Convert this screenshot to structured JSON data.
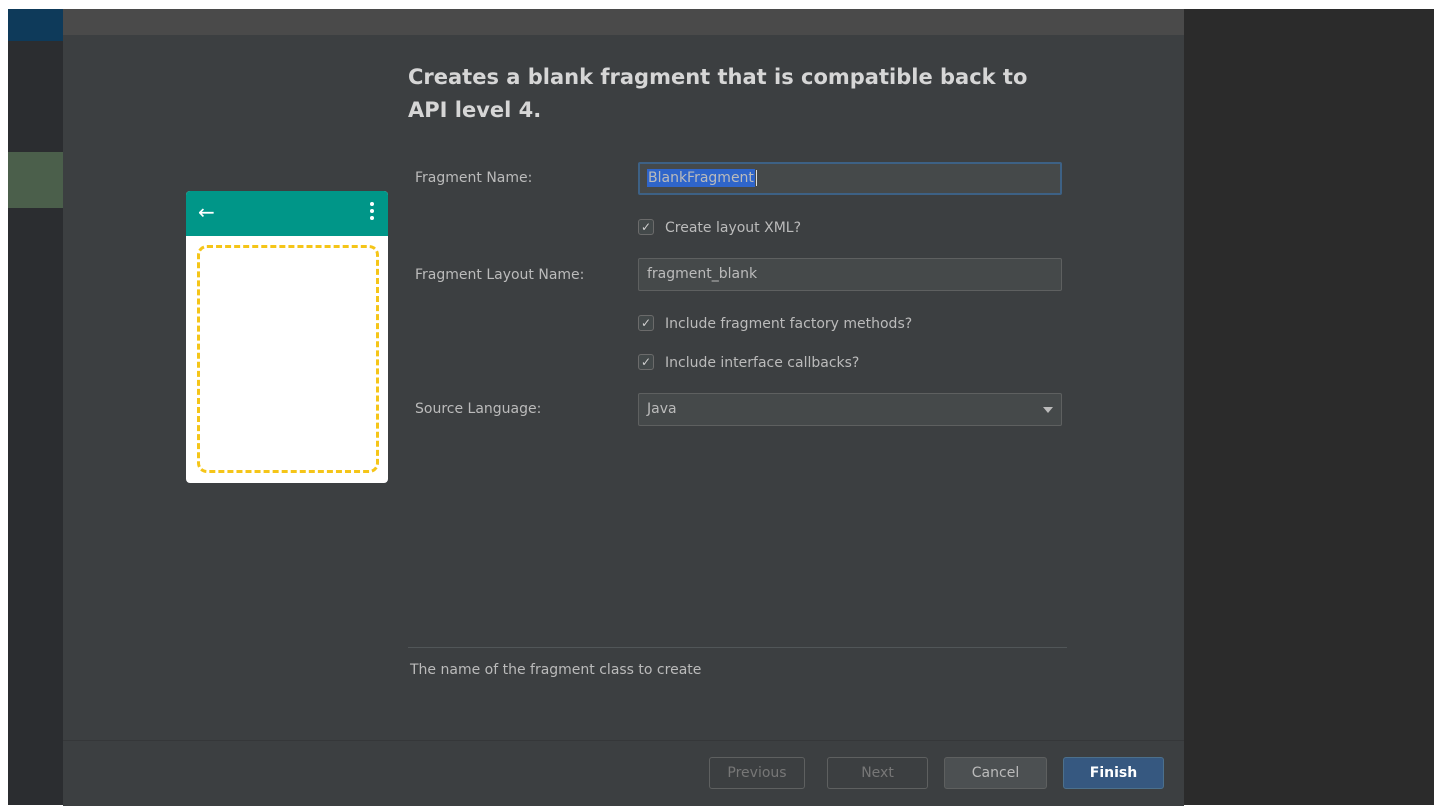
{
  "dialog": {
    "title": "Creates a blank fragment that is compatible back to API level 4."
  },
  "preview": {
    "back_icon": "←",
    "menu_icon": "more-vert-icon",
    "appbar_color": "#009688",
    "fragment_outline_color": "#f5c518"
  },
  "form": {
    "fragment_name_label": "Fragment Name:",
    "fragment_name_value": "BlankFragment",
    "create_layout_label": "Create layout XML?",
    "create_layout_checked": true,
    "fragment_layout_label": "Fragment Layout Name:",
    "fragment_layout_value": "fragment_blank",
    "factory_methods_label": "Include fragment factory methods?",
    "factory_methods_checked": true,
    "interface_callbacks_label": "Include interface callbacks?",
    "interface_callbacks_checked": true,
    "source_language_label": "Source Language:",
    "source_language_value": "Java",
    "check_mark": "✓"
  },
  "hint": "The name of the fragment class to create",
  "buttons": {
    "previous": "Previous",
    "next": "Next",
    "cancel": "Cancel",
    "finish": "Finish"
  }
}
